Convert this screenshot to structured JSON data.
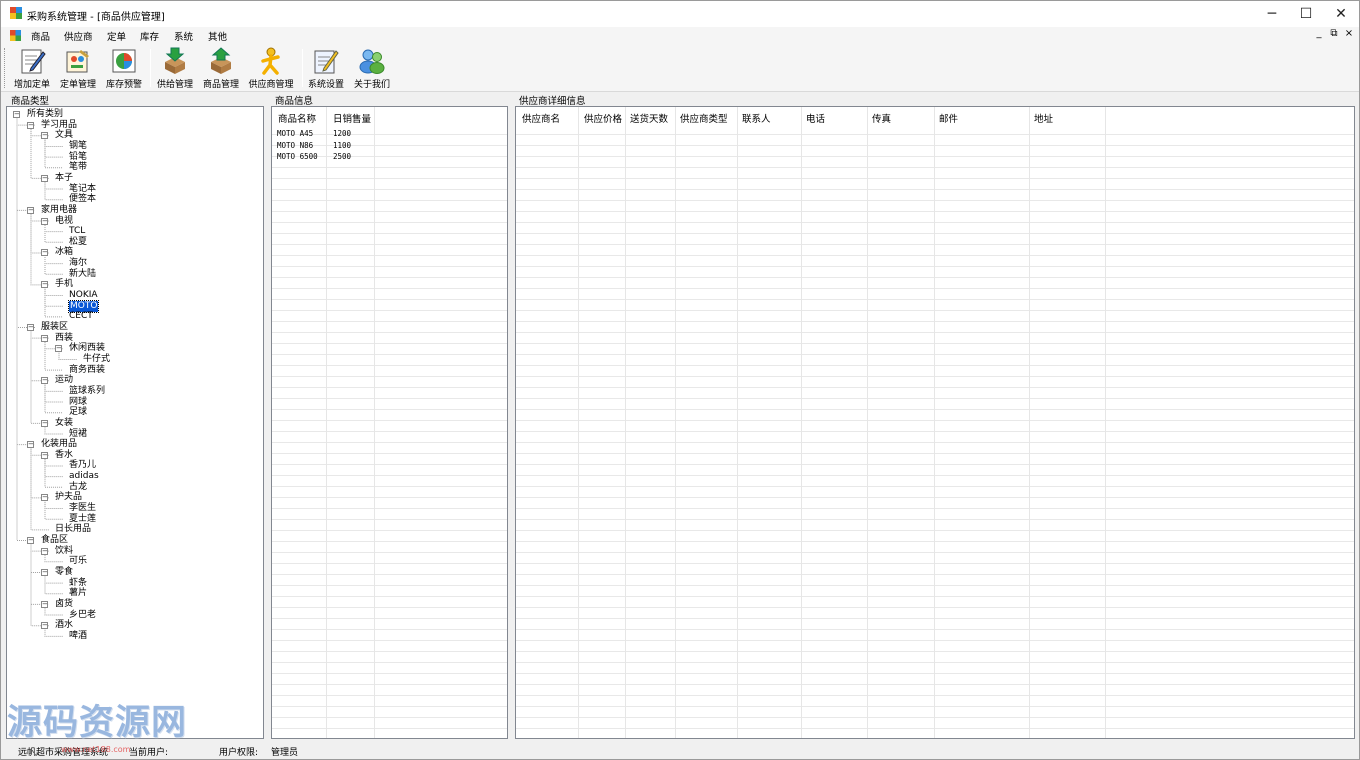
{
  "window": {
    "title": "采购系统管理 - [商品供应管理]",
    "minimize": "─",
    "maximize": "☐",
    "close": "✕"
  },
  "menu": {
    "items": [
      "商品",
      "供应商",
      "定单",
      "库存",
      "系统",
      "其他"
    ],
    "mdi_min": "_",
    "mdi_restore": "⧉",
    "mdi_close": "×"
  },
  "toolbar": {
    "buttons": [
      {
        "label": "增加定单",
        "icon": "add-order-icon"
      },
      {
        "label": "定单管理",
        "icon": "order-manage-icon"
      },
      {
        "label": "库存预警",
        "icon": "stock-warning-icon"
      },
      {
        "label": "供给管理",
        "icon": "supply-manage-icon"
      },
      {
        "label": "商品管理",
        "icon": "goods-manage-icon"
      },
      {
        "label": "供应商管理",
        "icon": "supplier-manage-icon"
      },
      {
        "label": "系统设置",
        "icon": "settings-icon"
      },
      {
        "label": "关于我们",
        "icon": "about-users-icon"
      }
    ]
  },
  "sections": {
    "categories": "商品类型",
    "goods": "商品信息",
    "supplier": "供应商详细信息"
  },
  "tree": [
    {
      "label": "所有类别",
      "level": 0,
      "toggle": "−"
    },
    {
      "label": "学习用品",
      "level": 1,
      "toggle": "−"
    },
    {
      "label": "文具",
      "level": 2,
      "toggle": "−"
    },
    {
      "label": "钢笔",
      "level": 3
    },
    {
      "label": "铅笔",
      "level": 3
    },
    {
      "label": "笔带",
      "level": 3
    },
    {
      "label": "本子",
      "level": 2,
      "toggle": "−"
    },
    {
      "label": "笔记本",
      "level": 3
    },
    {
      "label": "便签本",
      "level": 3
    },
    {
      "label": "家用电器",
      "level": 1,
      "toggle": "−"
    },
    {
      "label": "电视",
      "level": 2,
      "toggle": "−"
    },
    {
      "label": "TCL",
      "level": 3
    },
    {
      "label": "松夏",
      "level": 3
    },
    {
      "label": "冰箱",
      "level": 2,
      "toggle": "−"
    },
    {
      "label": "海尔",
      "level": 3
    },
    {
      "label": "新大陆",
      "level": 3
    },
    {
      "label": "手机",
      "level": 2,
      "toggle": "−"
    },
    {
      "label": "NOKIA",
      "level": 3
    },
    {
      "label": "MOTO",
      "level": 3,
      "selected": true
    },
    {
      "label": "CECT",
      "level": 3
    },
    {
      "label": "服装区",
      "level": 1,
      "toggle": "−"
    },
    {
      "label": "西装",
      "level": 2,
      "toggle": "−"
    },
    {
      "label": "休闲西装",
      "level": 3,
      "toggle": "−"
    },
    {
      "label": "牛仔式",
      "level": 4
    },
    {
      "label": "商务西装",
      "level": 3
    },
    {
      "label": "运动",
      "level": 2,
      "toggle": "−"
    },
    {
      "label": "篮球系列",
      "level": 3
    },
    {
      "label": "网球",
      "level": 3
    },
    {
      "label": "足球",
      "level": 3
    },
    {
      "label": "女装",
      "level": 2,
      "toggle": "−"
    },
    {
      "label": "短裙",
      "level": 3
    },
    {
      "label": "化装用品",
      "level": 1,
      "toggle": "−"
    },
    {
      "label": "香水",
      "level": 2,
      "toggle": "−"
    },
    {
      "label": "香乃儿",
      "level": 3
    },
    {
      "label": "adidas",
      "level": 3
    },
    {
      "label": "古龙",
      "level": 3
    },
    {
      "label": "护夫品",
      "level": 2,
      "toggle": "−"
    },
    {
      "label": "李医生",
      "level": 3
    },
    {
      "label": "夏士莲",
      "level": 3
    },
    {
      "label": "日长用品",
      "level": 2
    },
    {
      "label": "食品区",
      "level": 1,
      "toggle": "−"
    },
    {
      "label": "饮料",
      "level": 2,
      "toggle": "−"
    },
    {
      "label": "可乐",
      "level": 3
    },
    {
      "label": "零食",
      "level": 2,
      "toggle": "−"
    },
    {
      "label": "虾条",
      "level": 3
    },
    {
      "label": "薯片",
      "level": 3
    },
    {
      "label": "卤货",
      "level": 2,
      "toggle": "−"
    },
    {
      "label": "乡巴老",
      "level": 3
    },
    {
      "label": "酒水",
      "level": 2,
      "toggle": "−"
    },
    {
      "label": "啤酒",
      "level": 3
    }
  ],
  "goods_table": {
    "columns": [
      "商品名称",
      "日销售量"
    ],
    "rows": [
      [
        "MOTO A45",
        "1200"
      ],
      [
        "MOTO N86",
        "1100"
      ],
      [
        "MOTO 6500",
        "2500"
      ]
    ]
  },
  "supplier_table": {
    "columns": [
      "供应商名",
      "供应价格",
      "送货天数",
      "供应商类型",
      "联系人",
      "电话",
      "传真",
      "邮件",
      "地址"
    ]
  },
  "status": {
    "system": "远帆超市采购管理系统",
    "current_user_label": "当前用户:",
    "permission_label": "用户权限:",
    "permission_value": "管理员"
  },
  "watermark": {
    "text": "源码资源网",
    "url": "www.net188.com"
  }
}
